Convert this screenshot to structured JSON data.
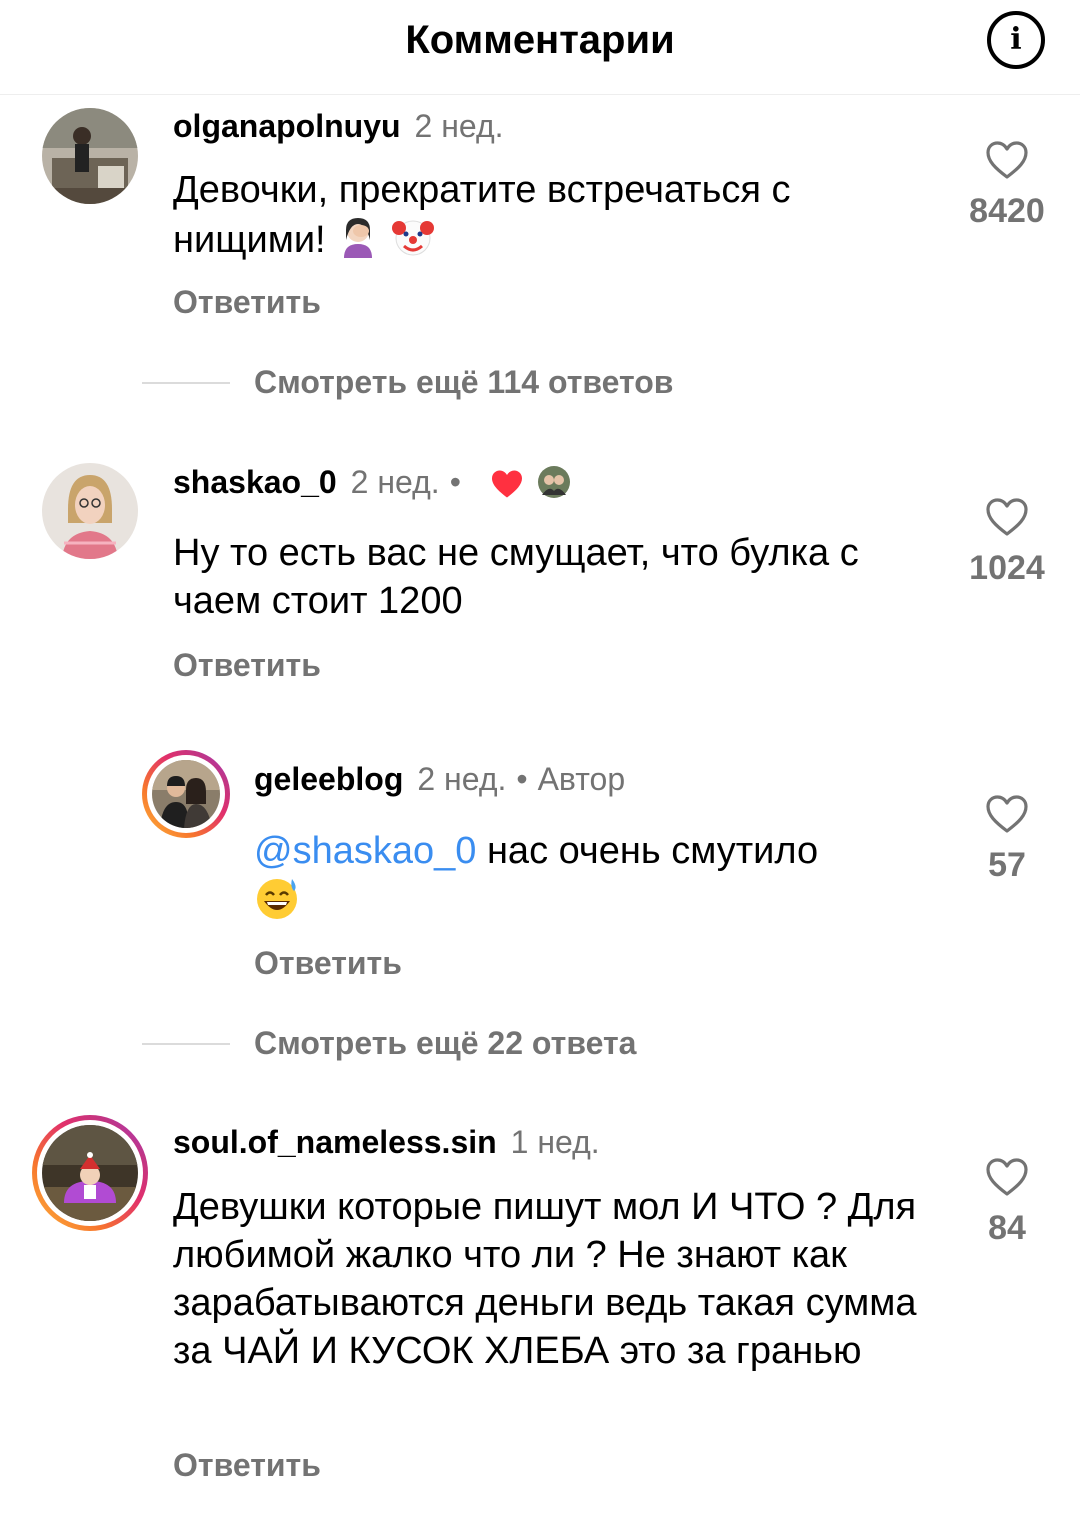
{
  "header": {
    "title": "Комментарии",
    "info_icon": "info-icon"
  },
  "comments": [
    {
      "username": "olganapolnuyu",
      "time": "2 нед.",
      "text": "Девочки, прекратите встречаться с нищими!",
      "emojis": [
        "facepalm-emoji",
        "clown-emoji"
      ],
      "reply_label": "Ответить",
      "likes": "8420",
      "view_replies": "Смотреть ещё 114 ответов"
    },
    {
      "username": "shaskao_0",
      "time": "2 нед.",
      "separator": "•",
      "author_liked": [
        "heart-icon",
        "author-avatar"
      ],
      "text": "Ну то есть вас не смущает, что булка с чаем стоит 1200",
      "reply_label": "Ответить",
      "likes": "1024",
      "replies": [
        {
          "username": "geleeblog",
          "time": "2 нед.",
          "separator": "•",
          "badge": "Автор",
          "mention": "@shaskao_0",
          "text": " нас очень смутило",
          "emojis": [
            "sweat-smile-emoji"
          ],
          "reply_label": "Ответить",
          "likes": "57"
        }
      ],
      "view_replies": "Смотреть ещё 22 ответа"
    },
    {
      "username": "soul.of_nameless.sin",
      "time": "1 нед.",
      "text": "Девушки которые пишут мол И ЧТО ? Для любимой жалко что ли ? Не знают как зарабатываются деньги ведь такая  сумма за ЧАЙ И КУСОК ХЛЕБА это за гранью",
      "reply_label": "Ответить",
      "likes": "84"
    }
  ],
  "colors": {
    "secondary": "#737373",
    "mention": "#3a8df0",
    "heart": "#ff3040"
  }
}
